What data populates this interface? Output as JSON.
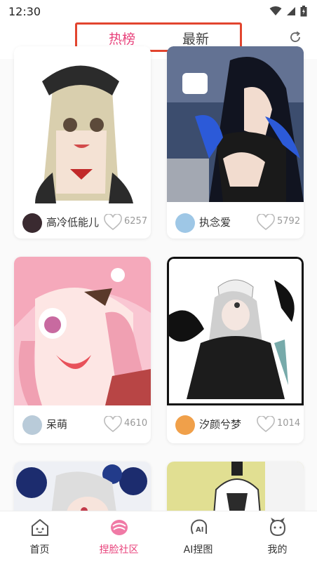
{
  "status_bar": {
    "time": "12:30"
  },
  "tabs": [
    {
      "label": "热榜",
      "active": true
    },
    {
      "label": "最新",
      "active": false
    }
  ],
  "accent_color": "#e8427b",
  "feed": [
    {
      "username": "高冷低能儿",
      "likes": "6257"
    },
    {
      "username": "执念爱",
      "likes": "5792"
    },
    {
      "username": "呆萌",
      "likes": "4610"
    },
    {
      "username": "汐颜兮梦",
      "likes": "1014"
    },
    {
      "username": "",
      "likes": ""
    },
    {
      "username": "",
      "likes": ""
    }
  ],
  "bottom_nav": [
    {
      "label": "首页",
      "icon": "home-icon",
      "active": false
    },
    {
      "label": "捏脸社区",
      "icon": "community-icon",
      "active": true
    },
    {
      "label": "AI捏图",
      "icon": "ai-icon",
      "active": false
    },
    {
      "label": "我的",
      "icon": "profile-icon",
      "active": false
    }
  ]
}
